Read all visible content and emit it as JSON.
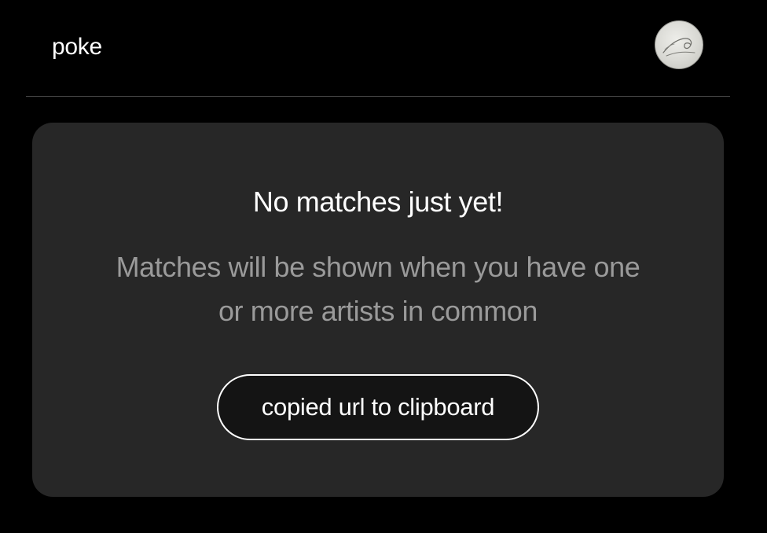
{
  "header": {
    "brand": "poke",
    "avatar_icon": "wave-sketch-avatar"
  },
  "empty_state": {
    "title": "No matches just yet!",
    "subtitle": "Matches will be shown when you have one or more artists in common",
    "button_label": "copied url to clipboard"
  },
  "colors": {
    "background": "#000000",
    "card": "#272727",
    "title": "#ffffff",
    "subtitle": "#9a9a9a",
    "button_border": "#ffffff"
  }
}
